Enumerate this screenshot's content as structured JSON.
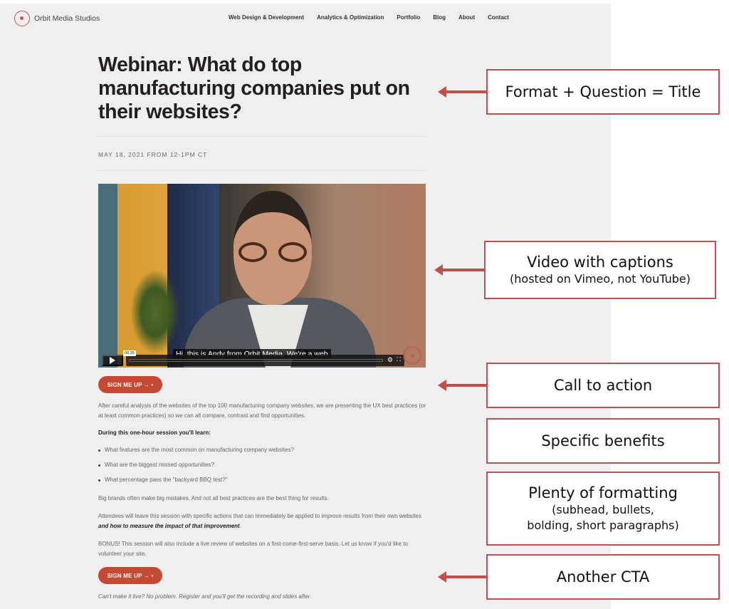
{
  "site": {
    "logo_text": "Orbit Media Studios",
    "nav": [
      "Web Design & Development",
      "Analytics & Optimization",
      "Portfolio",
      "Blog",
      "About",
      "Contact"
    ]
  },
  "article": {
    "title": "Webinar: What do top manufacturing companies put on their websites?",
    "date": "MAY 18, 2021 FROM 12-1PM CT",
    "video": {
      "caption": "Hi, this is Andy from Orbit Media. We're a web",
      "timestamp": "00:35",
      "icons": [
        "play-icon",
        "gear-icon",
        "fullscreen-icon"
      ]
    },
    "cta_label": "SIGN ME UP →  •",
    "intro": "After careful analysis of the websites of the top 100 manufacturing company websites, we are presenting the UX best practices (or at least common practices) so we can all compare, contrast and find opportunities.",
    "subhead": "During this one-hour session you'll learn:",
    "bullets": [
      "What features are the most common on manufacturing company websites?",
      "What are the biggest missed opportunities?",
      "What percentage pass the \"backyard BBQ test?\""
    ],
    "para2": "Big brands often make big mistakes. And not all best practices are the best thing for results.",
    "para3_plain": "Attendees will leave this session with specific actions that can immediately be applied to improve results from their own websites ",
    "para3_emphasis": "and how to measure the impact of that improvement",
    "para3_end": ".",
    "para4": "BONUS! This session will also include a live review of websites on a first-come-first-serve basis. Let us know if you'd like to volunteer your site.",
    "cta2_label": "SIGN ME UP →  •",
    "footer_note": "Can't make it live? No problem. Register and you'll get the recording and slides after."
  },
  "annotations": [
    {
      "main": "Format + Question = Title",
      "sub": ""
    },
    {
      "main": "Video with captions",
      "sub": "(hosted on Vimeo, not YouTube)"
    },
    {
      "main": "Call to action",
      "sub": ""
    },
    {
      "main": "Specific benefits",
      "sub": ""
    },
    {
      "main": "Plenty of formatting",
      "sub": "(subhead, bullets,",
      "sub2": "bolding, short paragraphs)"
    },
    {
      "main": "Another CTA",
      "sub": ""
    }
  ],
  "colors": {
    "accent": "#c44a34",
    "annotation_border": "#c0504d",
    "page_bg": "#efefef"
  }
}
